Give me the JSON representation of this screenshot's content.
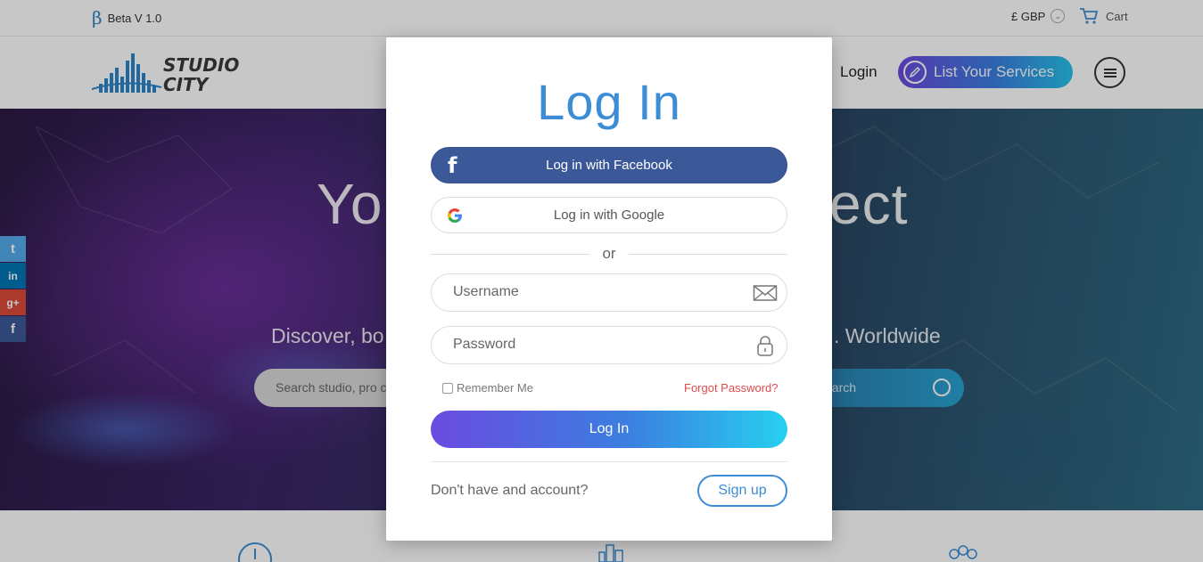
{
  "topbar": {
    "beta_symbol": "β",
    "beta_label": "Beta V 1.0",
    "currency": "£ GBP",
    "cart_label": "Cart"
  },
  "nav": {
    "login_label": "Login",
    "list_services_label": "List Your Services"
  },
  "hero": {
    "title_left": "Yo",
    "title_right": "ect",
    "subtitle_left": "Discover, bo",
    "subtitle_right": ". Worldwide",
    "search_placeholder": "Search studio, pro c",
    "search_button": "earch"
  },
  "social": [
    {
      "name": "twitter",
      "glyph": "t",
      "color": "#55acee"
    },
    {
      "name": "linkedin",
      "glyph": "in",
      "color": "#0077b5"
    },
    {
      "name": "google-plus",
      "glyph": "g+",
      "color": "#dd4b39"
    },
    {
      "name": "facebook",
      "glyph": "f",
      "color": "#3b5998"
    }
  ],
  "modal": {
    "title": "Log In",
    "facebook_label": "Log in with Facebook",
    "google_label": "Log in with Google",
    "or_label": "or",
    "username_placeholder": "Username",
    "password_placeholder": "Password",
    "remember_label": "Remember Me",
    "forgot_label": "Forgot Password?",
    "login_button": "Log In",
    "no_account_text": "Don't have and account?",
    "signup_label": "Sign up"
  },
  "colors": {
    "accent_blue": "#3d8dd6",
    "facebook": "#3b5998",
    "forgot_red": "#e24a4a"
  }
}
